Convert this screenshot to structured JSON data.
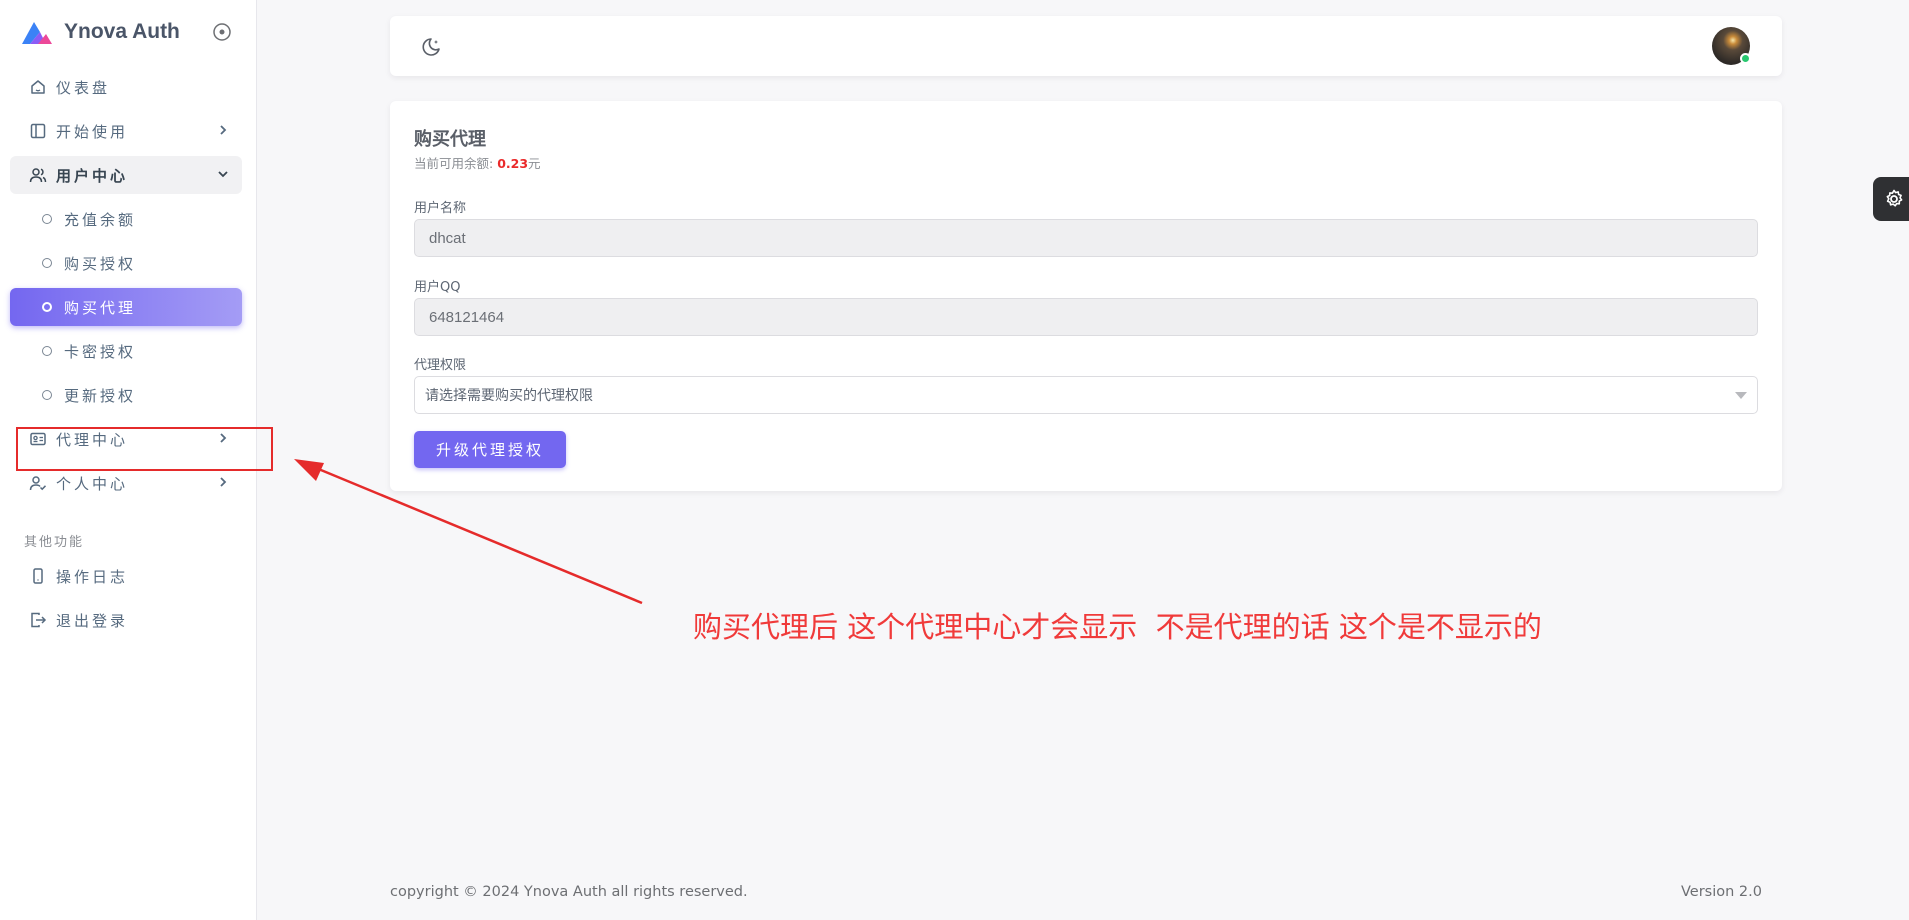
{
  "brand": {
    "name": "Ynova Auth"
  },
  "sidebar": {
    "items": [
      {
        "label": "仪表盘",
        "icon": "home-icon"
      },
      {
        "label": "开始使用",
        "icon": "layout-sidebar-icon"
      },
      {
        "label": "用户中心",
        "icon": "users-icon",
        "expanded": true
      },
      {
        "label": "充值余额"
      },
      {
        "label": "购买授权"
      },
      {
        "label": "购买代理",
        "active": true
      },
      {
        "label": "卡密授权"
      },
      {
        "label": "更新授权"
      },
      {
        "label": "代理中心",
        "icon": "id-card-icon"
      },
      {
        "label": "个人中心",
        "icon": "user-check-icon"
      }
    ],
    "section_title": "其他功能",
    "other_items": [
      {
        "label": "操作日志",
        "icon": "device-mobile-icon"
      },
      {
        "label": "退出登录",
        "icon": "logout-icon"
      }
    ]
  },
  "header": {
    "theme_icon": "moon-stars-icon"
  },
  "form": {
    "title": "购买代理",
    "balance_label": "当前可用余额:",
    "balance_amount": "0.23",
    "balance_unit": "元",
    "username_label": "用户名称",
    "username_value": "dhcat",
    "qq_label": "用户QQ",
    "qq_value": "648121464",
    "permission_label": "代理权限",
    "permission_placeholder": "请选择需要购买的代理权限",
    "submit_label": "升级代理授权"
  },
  "annotation": {
    "text": "购买代理后 这个代理中心才会显示  不是代理的话 这个是不显示的",
    "color": "#f03a3a"
  },
  "footer": {
    "copyright": "copyright © 2024 Ynova Auth all rights reserved.",
    "version": "Version 2.0"
  },
  "colors": {
    "primary": "#7367f0",
    "danger": "#ea2a2a",
    "online": "#28c76f"
  }
}
